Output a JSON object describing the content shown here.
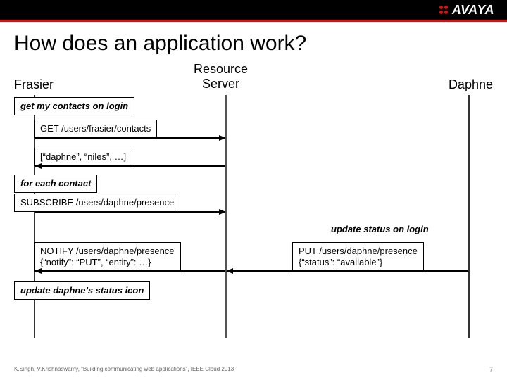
{
  "brand": {
    "name": "AVAYA"
  },
  "title": "How does an application work?",
  "actors": {
    "left": "Frasier",
    "mid": "Resource\nServer",
    "right": "Daphne"
  },
  "seq": {
    "step1_note": "get my contacts on login",
    "step2_req": "GET /users/frasier/contacts",
    "step3_resp": "[“daphne”, “niles”, …]",
    "step4_note": "for each contact",
    "step5_sub": "SUBSCRIBE /users/daphne/presence",
    "step6_note": "update status on login",
    "step7_put": "PUT /users/daphne/presence\n{“status”: “available”}",
    "step8_notify": "NOTIFY /users/daphne/presence\n{“notify”: “PUT”, “entity”: …}",
    "step9_note": "update daphne’s status icon"
  },
  "footer": {
    "citation": "K.Singh, V.Krishnaswamy, “Building communicating web applications”, IEEE Cloud 2013",
    "page": "7"
  },
  "chart_data": {
    "type": "sequence-diagram",
    "actors": [
      "Frasier",
      "Resource Server",
      "Daphne"
    ],
    "events": [
      {
        "kind": "note",
        "at": "Frasier",
        "text": "get my contacts on login"
      },
      {
        "kind": "message",
        "from": "Frasier",
        "to": "Resource Server",
        "label": "GET /users/frasier/contacts"
      },
      {
        "kind": "message",
        "from": "Resource Server",
        "to": "Frasier",
        "label": "[\"daphne\", \"niles\", ...]"
      },
      {
        "kind": "note",
        "at": "Frasier",
        "text": "for each contact"
      },
      {
        "kind": "message",
        "from": "Frasier",
        "to": "Resource Server",
        "label": "SUBSCRIBE /users/daphne/presence"
      },
      {
        "kind": "note",
        "at": "Daphne",
        "text": "update status on login"
      },
      {
        "kind": "message",
        "from": "Daphne",
        "to": "Resource Server",
        "label": "PUT /users/daphne/presence {\"status\": \"available\"}"
      },
      {
        "kind": "message",
        "from": "Resource Server",
        "to": "Frasier",
        "label": "NOTIFY /users/daphne/presence {\"notify\": \"PUT\", \"entity\": ...}"
      },
      {
        "kind": "note",
        "at": "Frasier",
        "text": "update daphne's status icon"
      }
    ]
  }
}
